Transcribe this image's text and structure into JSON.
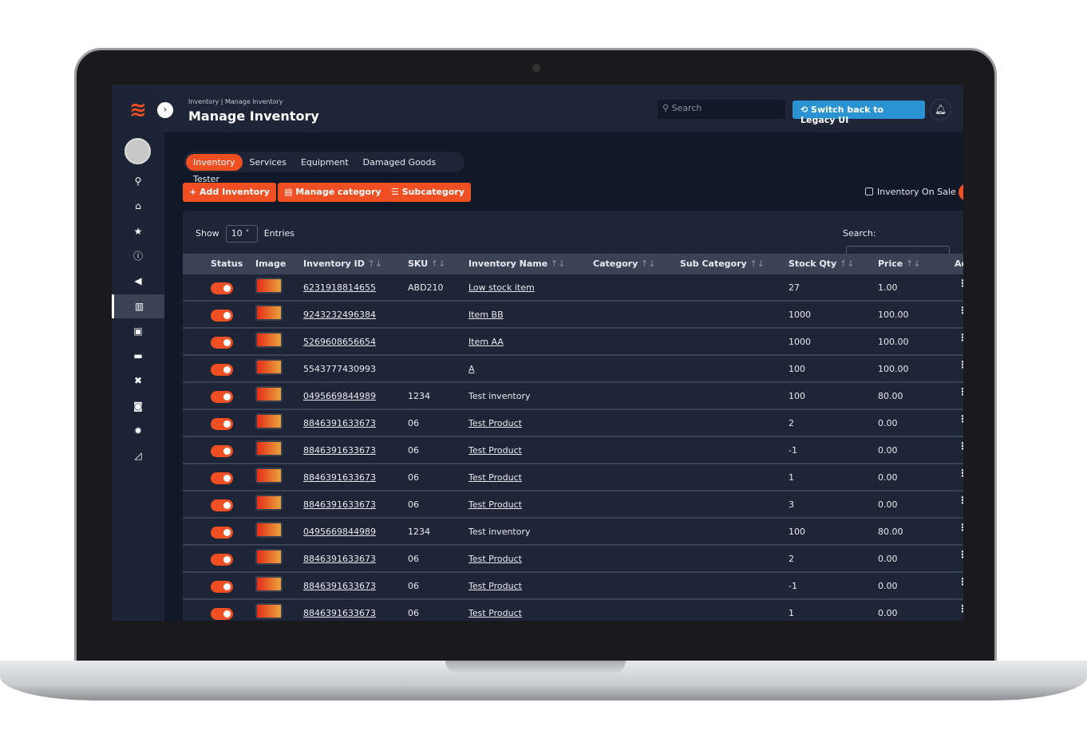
{
  "header": {
    "breadcrumb": "Inventory | Manage Inventory",
    "title": "Manage Inventory",
    "search_placeholder": "Search",
    "legacy_label": "Switch back to Legacy UI"
  },
  "sidebar": {
    "items": [
      "search-icon",
      "home-icon",
      "star-icon",
      "info-icon",
      "megaphone-icon",
      "warehouse-icon",
      "briefcase-icon",
      "card-icon",
      "tools-icon",
      "chat-icon",
      "gear-icon",
      "chart-icon"
    ],
    "active": "warehouse-icon"
  },
  "tabs": [
    "Inventory",
    "Services",
    "Equipment",
    "Damaged Goods",
    "Tester"
  ],
  "actions": {
    "add": "+ Add Inventory",
    "manage": "▤ Manage category",
    "sub": "☰ Subcategory",
    "on_sale": "Inventory On Sale"
  },
  "table": {
    "show": "Show",
    "entries_value": "10",
    "entries": "Entries",
    "search_label": "Search:",
    "columns": [
      "Status",
      "Image",
      "Inventory ID",
      "SKU",
      "Inventory Name",
      "Category",
      "Sub Category",
      "Stock Qty",
      "Price",
      "Ac"
    ],
    "rows": [
      [
        "6231918814655",
        "ABD210",
        "Low stock item",
        "27",
        "1.00"
      ],
      [
        "9243232496384",
        "",
        "Item BB",
        "1000",
        "100.00"
      ],
      [
        "5269608656654",
        "",
        "Item AA",
        "1000",
        "100.00"
      ],
      [
        "5543777430993",
        "",
        "A",
        "100",
        "100.00"
      ],
      [
        "0495669844989",
        "1234",
        "Test inventory",
        "100",
        "80.00"
      ],
      [
        "8846391633673",
        "06",
        "Test Product",
        "2",
        "0.00"
      ],
      [
        "8846391633673",
        "06",
        "Test Product",
        "-1",
        "0.00"
      ],
      [
        "8846391633673",
        "06",
        "Test Product",
        "1",
        "0.00"
      ],
      [
        "8846391633673",
        "06",
        "Test Product",
        "3",
        "0.00"
      ],
      [
        "0495669844989",
        "1234",
        "Test inventory",
        "100",
        "80.00"
      ],
      [
        "8846391633673",
        "06",
        "Test Product",
        "2",
        "0.00"
      ],
      [
        "8846391633673",
        "06",
        "Test Product",
        "-1",
        "0.00"
      ],
      [
        "8846391633673",
        "06",
        "Test Product",
        "1",
        "0.00"
      ]
    ]
  },
  "colors": {
    "accent": "#f04e23",
    "legacy": "#2b93d1",
    "bg": "#111828"
  }
}
